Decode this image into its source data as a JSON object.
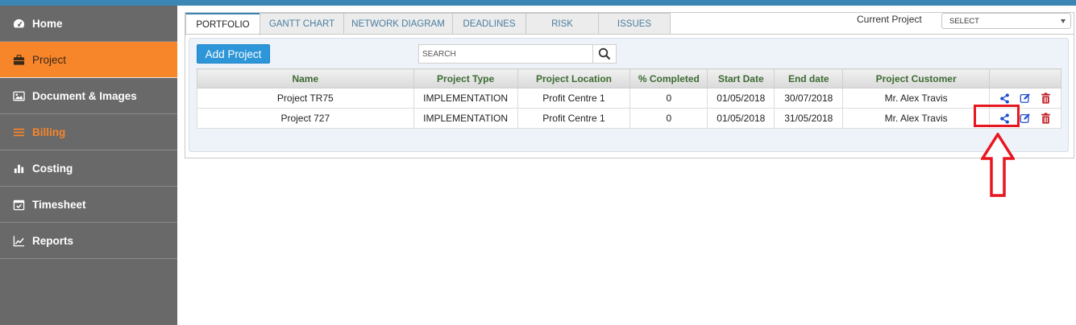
{
  "sidebar": {
    "items": [
      {
        "label": "Home",
        "icon": "dashboard-icon"
      },
      {
        "label": "Project",
        "icon": "briefcase-icon"
      },
      {
        "label": "Document & Images",
        "icon": "image-icon"
      },
      {
        "label": "Billing",
        "icon": "list-icon"
      },
      {
        "label": "Costing",
        "icon": "bar-chart-icon"
      },
      {
        "label": "Timesheet",
        "icon": "calendar-check-icon"
      },
      {
        "label": "Reports",
        "icon": "line-chart-icon"
      }
    ]
  },
  "tabs": [
    "PORTFOLIO",
    "GANTT CHART",
    "NETWORK DIAGRAM",
    "DEADLINES",
    "RISK",
    "ISSUES"
  ],
  "current_project": {
    "label": "Current Project",
    "value": "SELECT"
  },
  "toolbar": {
    "add_label": "Add Project",
    "search_placeholder": "SEARCH"
  },
  "table": {
    "headers": [
      "Name",
      "Project Type",
      "Project Location",
      "% Completed",
      "Start Date",
      "End date",
      "Project Customer"
    ],
    "rows": [
      [
        "Project TR75",
        "IMPLEMENTATION",
        "Profit Centre 1",
        "0",
        "01/05/2018",
        "30/07/2018",
        "Mr. Alex Travis"
      ],
      [
        "Project 727",
        "IMPLEMENTATION",
        "Profit Centre 1",
        "0",
        "01/05/2018",
        "31/05/2018",
        "Mr. Alex Travis"
      ]
    ]
  },
  "colors": {
    "accent": "#f7852a",
    "primary": "#2d96d9",
    "sidebar": "#696969",
    "header_text": "#3d6b32",
    "annotation": "#e8161f"
  }
}
